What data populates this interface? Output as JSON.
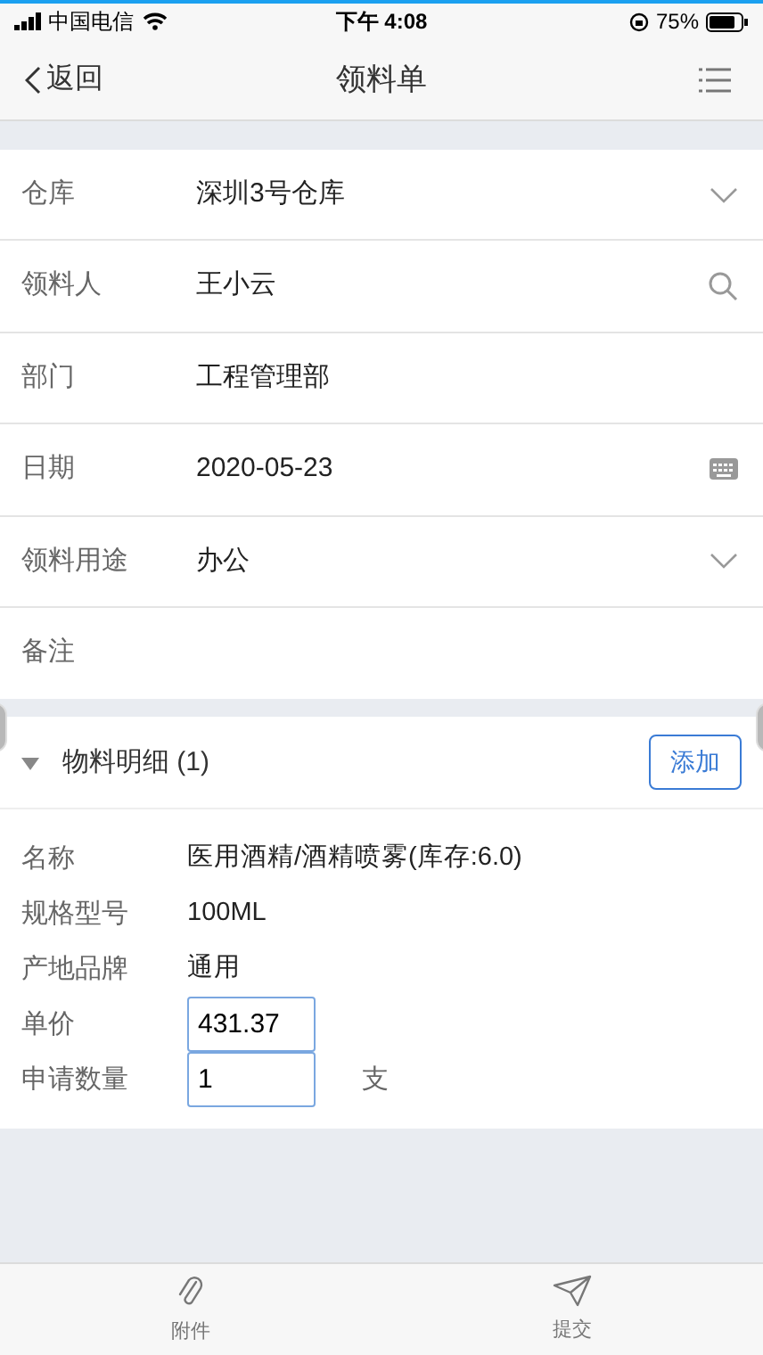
{
  "status_bar": {
    "carrier": "中国电信",
    "time": "下午 4:08",
    "battery": "75%"
  },
  "nav": {
    "back": "返回",
    "title": "领料单"
  },
  "form": [
    {
      "label": "仓库",
      "value": "深圳3号仓库",
      "kind": "dropdown"
    },
    {
      "label": "领料人",
      "value": "王小云",
      "kind": "search"
    },
    {
      "label": "部门",
      "value": "工程管理部",
      "kind": "text"
    },
    {
      "label": "日期",
      "value": "2020-05-23",
      "kind": "date"
    },
    {
      "label": "领料用途",
      "value": "办公",
      "kind": "dropdown"
    },
    {
      "label": "备注",
      "kind": "text"
    }
  ],
  "details": {
    "title": "物料明细 (1)",
    "expanded": true,
    "add_button": "添加",
    "rows": [
      {
        "label": "名称",
        "value": "医用酒精/酒精喷雾(库存:6.0)",
        "kind": "text"
      },
      {
        "label": "规格型号",
        "value": "100ML",
        "kind": "text"
      },
      {
        "label": "产地品牌",
        "value": "通用",
        "kind": "text"
      },
      {
        "label": "单价",
        "value": "431.37",
        "kind": "input"
      },
      {
        "label": "申请数量",
        "value": "1",
        "kind": "input",
        "unit": "支"
      }
    ]
  },
  "tab_bar": [
    {
      "label": "附件",
      "kind": "attach"
    },
    {
      "label": "提交",
      "kind": "send"
    }
  ]
}
